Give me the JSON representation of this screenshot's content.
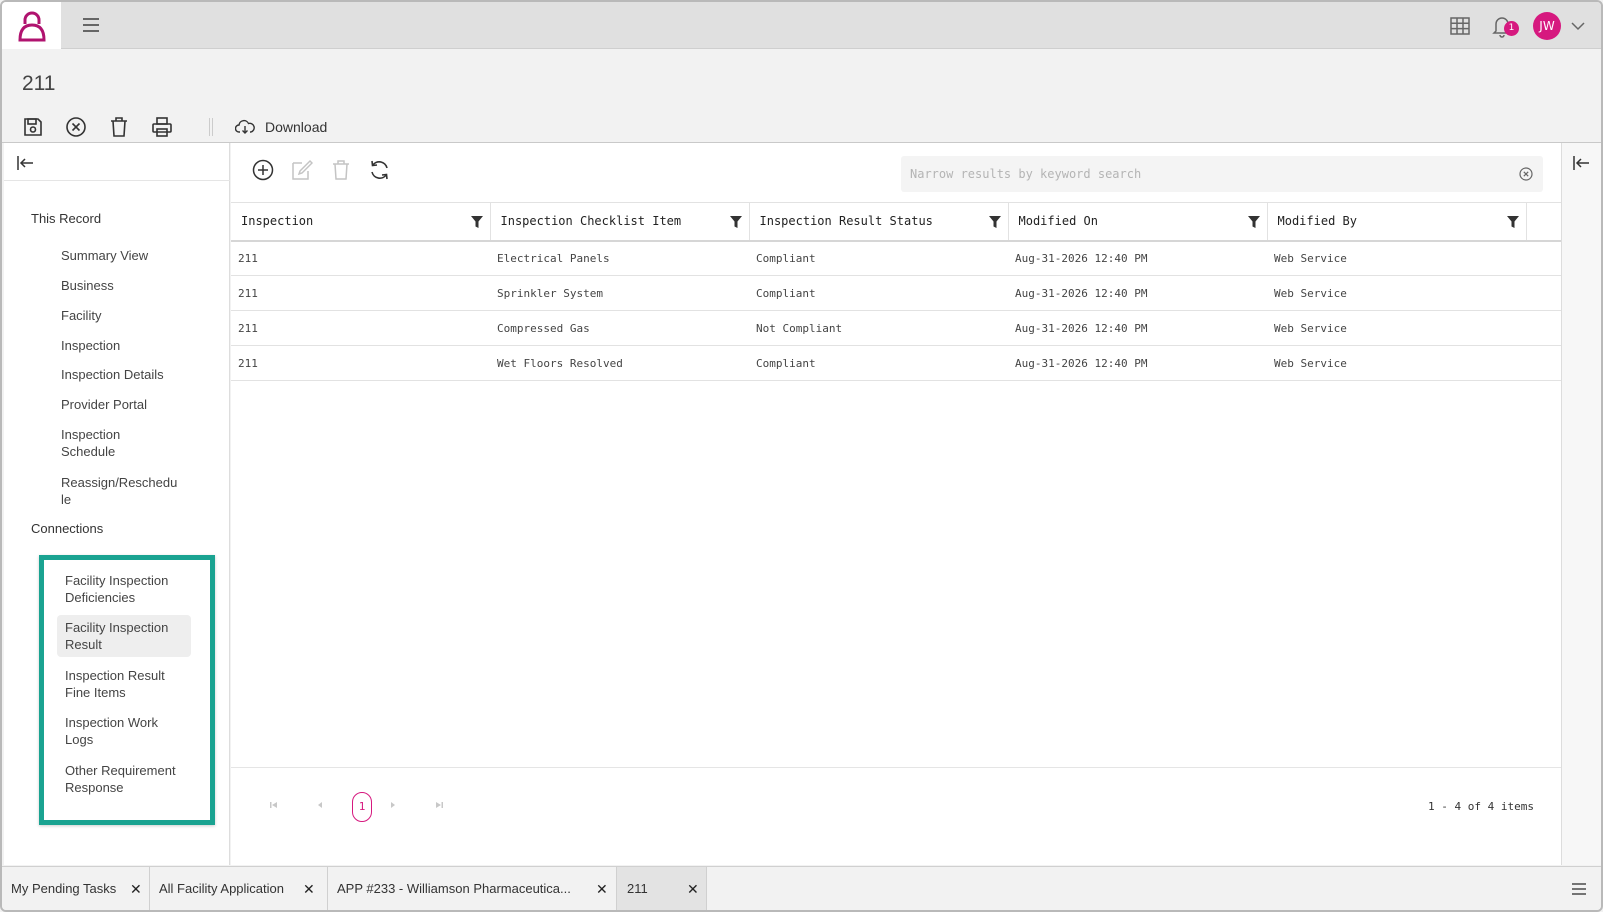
{
  "header": {
    "record_title": "211",
    "avatar_initials": "JW",
    "notification_count": "1",
    "download_label": "Download"
  },
  "sidebar": {
    "this_record_label": "This Record",
    "record_items": [
      {
        "label": "Summary View"
      },
      {
        "label": "Business"
      },
      {
        "label": "Facility"
      },
      {
        "label": "Inspection"
      },
      {
        "label": "Inspection Details"
      },
      {
        "label": "Provider Portal"
      },
      {
        "label": "Inspection Schedule"
      },
      {
        "label": "Reassign/Reschedule"
      }
    ],
    "connections_label": "Connections",
    "connection_items": [
      {
        "label": "Facility Inspection Deficiencies"
      },
      {
        "label": "Facility Inspection Result",
        "active": true
      },
      {
        "label": "Inspection Result Fine Items"
      },
      {
        "label": "Inspection Work Logs"
      },
      {
        "label": "Other Requirement Response"
      }
    ]
  },
  "grid": {
    "search_placeholder": "Narrow results by keyword search",
    "columns": [
      "Inspection",
      "Inspection Checklist Item",
      "Inspection Result Status",
      "Modified On",
      "Modified By"
    ],
    "rows": [
      [
        "211",
        "Electrical Panels",
        "Compliant",
        "Aug-31-2026 12:40 PM",
        "Web Service"
      ],
      [
        "211",
        "Sprinkler System",
        "Compliant",
        "Aug-31-2026 12:40 PM",
        "Web Service"
      ],
      [
        "211",
        "Compressed Gas",
        "Not Compliant",
        "Aug-31-2026 12:40 PM",
        "Web Service"
      ],
      [
        "211",
        "Wet Floors Resolved",
        "Compliant",
        "Aug-31-2026 12:40 PM",
        "Web Service"
      ]
    ],
    "current_page": "1",
    "pager_info": "1 - 4 of 4 items"
  },
  "tabs": [
    {
      "label": "My Pending Tasks"
    },
    {
      "label": "All Facility Application"
    },
    {
      "label": "APP #233 - Williamson Pharmaceutica..."
    },
    {
      "label": "211",
      "active": true
    }
  ],
  "colors": {
    "accent": "#d6197f",
    "highlight_border": "#1aa391"
  }
}
